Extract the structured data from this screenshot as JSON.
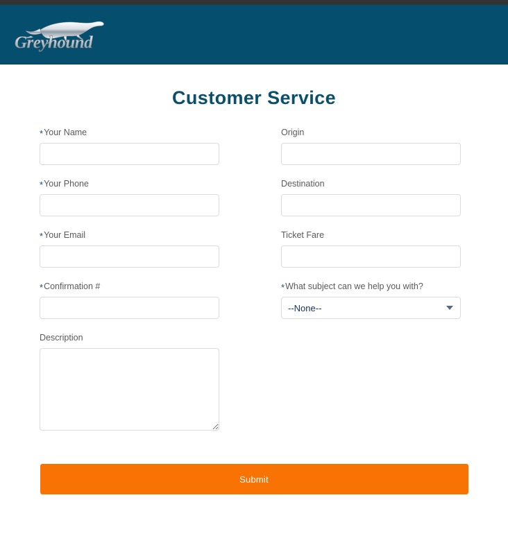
{
  "brand": {
    "name": "Greyhound",
    "logo_icon": "greyhound-dog-icon",
    "header_color": "#064e6d",
    "top_strip_color": "#333333"
  },
  "page": {
    "title": "Customer Service",
    "title_color": "#0a4f6b"
  },
  "form": {
    "left_fields": [
      {
        "label": "Your Name",
        "required": true,
        "star": "*",
        "value": "",
        "placeholder": "",
        "type": "text"
      },
      {
        "label": "Your Phone",
        "required": true,
        "star": "*",
        "value": "",
        "placeholder": "",
        "type": "text"
      },
      {
        "label": "Your Email",
        "required": true,
        "star": "*",
        "value": "",
        "placeholder": "",
        "type": "text"
      },
      {
        "label": "Confirmation #",
        "required": true,
        "star": "*",
        "value": "",
        "placeholder": "",
        "type": "text"
      },
      {
        "label": "Description",
        "required": false,
        "star": "",
        "value": "",
        "placeholder": "",
        "type": "textarea"
      }
    ],
    "right_fields": [
      {
        "label": "Origin",
        "required": false,
        "star": "",
        "value": "",
        "placeholder": "",
        "type": "text"
      },
      {
        "label": "Destination",
        "required": false,
        "star": "",
        "value": "",
        "placeholder": "",
        "type": "text"
      },
      {
        "label": "Ticket Fare",
        "required": false,
        "star": "",
        "value": "",
        "placeholder": "",
        "type": "text"
      },
      {
        "label": "What subject can we help you with?",
        "required": true,
        "star": "*",
        "value": "--None--",
        "type": "select"
      }
    ],
    "subject_selected": "--None--",
    "dropdown_icon": "chevron-down-icon"
  },
  "submit": {
    "label": "Submit",
    "color": "#f97304"
  }
}
